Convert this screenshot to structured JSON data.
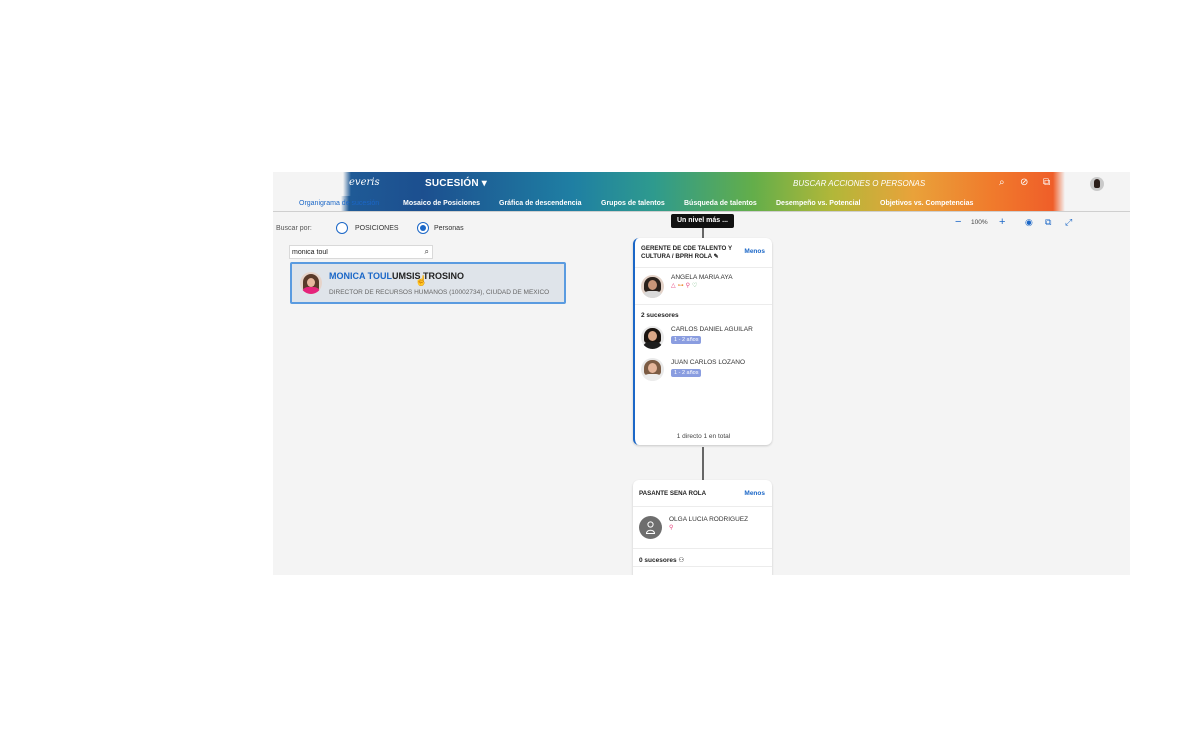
{
  "header": {
    "logo": "everis",
    "module": "SUCESIÓN ▾",
    "global_search": "BUSCAR ACCIONES O PERSONAS"
  },
  "nav": {
    "items": [
      "Organigrama de sucesión",
      "Mosaico de Posiciones",
      "Gráfica de descendencia",
      "Grupos de talentos",
      "Búsqueda de talentos",
      "Desempeño vs. Potencial",
      "Objetivos vs. Competencias"
    ]
  },
  "zoom": {
    "minus": "−",
    "level": "100%",
    "plus": "+"
  },
  "search": {
    "buscar_por": "Buscar por:",
    "option_posiciones": "POSICIONES",
    "option_personas": "Personas",
    "selected": "Personas",
    "query": "monica toul",
    "result": {
      "name_match": "MONICA TOUL",
      "name_rest": "UMSIS TROSINO",
      "subtitle": "DIRECTOR DE RECURSOS HUMANOS (10002734), CIUDAD DE MEXICO"
    }
  },
  "org": {
    "level_tip": "Un nivel más ...",
    "card1": {
      "title": "GERENTE DE CDE TALENTO Y CULTURA / BPRH ROLA",
      "toggle": "Menos",
      "incumbent": "ANGELA MARIA AYA",
      "successors_label": "2 sucesores",
      "successors": [
        {
          "name": "CARLOS DANIEL AGUILAR",
          "readiness": "1 - 2 años"
        },
        {
          "name": "JUAN CARLOS LOZANO",
          "readiness": "1 - 2 años"
        }
      ],
      "footer": "1 directo 1 en total"
    },
    "card2": {
      "title": "PASANTE SENA ROLA",
      "toggle": "Menos",
      "incumbent": "OLGA LUCIA RODRIGUEZ",
      "successors_label": "0 sucesores"
    }
  },
  "colors": {
    "accent": "#1b67c7",
    "badge": "#8a9de0"
  }
}
